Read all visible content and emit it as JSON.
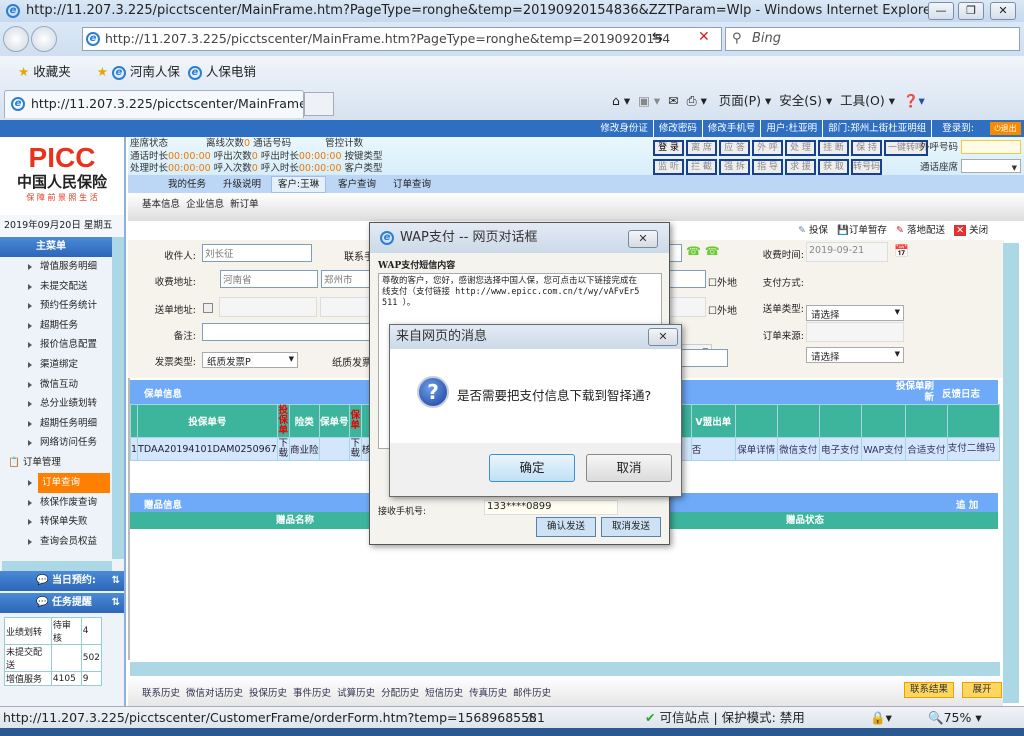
{
  "browser": {
    "title": "http://11.207.3.225/picctscenter/MainFrame.htm?PageType=ronghe&temp=20190920154836&ZZTParam=Wlp - Windows Internet Explorer",
    "address": "http://11.207.3.225/picctscenter/MainFrame.htm?PageType=ronghe&temp=20190920154",
    "search_placeholder": "Bing",
    "favorites": "收藏夹",
    "fav_links": [
      "河南人保",
      "人保电销"
    ],
    "tab_title": "http://11.207.3.225/picctscenter/MainFrame....",
    "commands": [
      "页面(P)",
      "安全(S)",
      "工具(O)"
    ],
    "status_url": "http://11.207.3.225/picctscenter/CustomerFrame/orderForm.htm?temp=15689685581",
    "trusted": "可信站点 | 保护模式: 禁用",
    "zoom": "75%"
  },
  "top_links": [
    "修改身份证",
    "修改密码",
    "修改手机号",
    "用户:杜亚明",
    "部门:郑州上街杜亚明组",
    "登录到:"
  ],
  "logout": "退出",
  "logo": {
    "brand": "PICC",
    "name": "中国人民保险",
    "slogan": "保 障 前 景 照 生 活"
  },
  "date": "2019年09月20日  星期五",
  "menu": {
    "header": "主菜单",
    "items": [
      "增值服务明细",
      "未提交配送",
      "预约任务统计",
      "超期任务",
      "报价信息配置",
      "渠道绑定",
      "微信互动",
      "总分业绩划转",
      "超期任务明细",
      "网络访问任务"
    ],
    "group": "订单管理",
    "group_items": [
      "订单查询",
      "核保作废查询",
      "转保单失败",
      "查询会员权益"
    ],
    "active": "订单查询"
  },
  "today_appt": "当日预约:",
  "task_remind": "任务提醒",
  "task_table": [
    [
      "业绩划转",
      "待审核",
      "4"
    ],
    [
      "未提交配送",
      "",
      "502"
    ],
    [
      "增值服务",
      "4105",
      "9"
    ]
  ],
  "status_panel": {
    "seat": "座席状态",
    "lost": "离线次数",
    "lost_v": "0",
    "callno": "通话号码",
    "ctrl": "管控计数",
    "talk": "通话时长",
    "talk_v": "00:00:00",
    "outc": "呼出次数",
    "outc_v": "0",
    "outt": "呼出时长",
    "outt_v": "00:00:00",
    "key": "按键类型",
    "proc": "处理时长",
    "proc_v": "00:00:00",
    "inc": "呼入次数",
    "inc_v": "0",
    "int": "呼入时长",
    "int_v": "00:00:00",
    "ctype": "客户类型"
  },
  "cti_row1": [
    "登 录",
    "离 席",
    "应 答",
    "外 呼",
    "处 理",
    "挂 断",
    "保 持",
    "一键转呼"
  ],
  "cti_row2": [
    "监 听",
    "拦 截",
    "强 拆",
    "指 导",
    "求 援",
    "获 取",
    "转号码"
  ],
  "outcall_label": "外呼号码",
  "seat_label": "通话座席",
  "tabs": [
    "我的任务",
    "升级说明",
    "客户:王琳",
    "客户查询",
    "订单查询"
  ],
  "subtabs": [
    "基本信息",
    "企业信息",
    "新订单"
  ],
  "toolbar": [
    "投保",
    "订单暂存",
    "落地配送",
    "关闭"
  ],
  "form": {
    "receiver_l": "收件人:",
    "receiver": "刘长征",
    "contact_l": "联系手",
    "addr_l": "收费地址:",
    "province": "河南省",
    "city": "郑州市",
    "send_l": "送单地址:",
    "remark_l": "备注:",
    "invoice_l": "发票类型:",
    "invoice": "纸质发票P",
    "paper_l": "纸质发票",
    "outside": "外地",
    "time_l": "收费时间:",
    "time": "2019-09-21",
    "pay_l": "支付方式:",
    "pay": "请选择",
    "sendtype_l": "送单类型:",
    "sendtype": "请选择",
    "source_l": "订单来源:"
  },
  "policy": {
    "header": "保单信息",
    "refresh": "投保单刷新",
    "feedback": "反馈日志",
    "cols": [
      "投保单号",
      "投保单",
      "险类",
      "保单号",
      "保单",
      "状",
      "入",
      "V盟出单",
      "",
      "",
      "",
      "",
      ""
    ],
    "row": [
      "1",
      "TDAA20194101DAM0250967",
      "下载",
      "商业险",
      "",
      "下载",
      "核保",
      "",
      "否",
      "保单详情",
      "微信支付",
      "电子支付",
      "WAP支付",
      "合适支付",
      "支付二维码"
    ]
  },
  "gift": {
    "header": "赠品信息",
    "add": "追 加",
    "col1": "赠品名称",
    "col2": "赠品状态"
  },
  "bottom_links": [
    "联系历史",
    "微信对话历史",
    "投保历史",
    "事件历史",
    "试算历史",
    "分配历史",
    "短信历史",
    "传真历史",
    "邮件历史"
  ],
  "bottom_btns": [
    "联系结果",
    "展开"
  ],
  "wap": {
    "title": "WAP支付 -- 网页对话框",
    "section": "WAP支付短信内容",
    "text": "尊敬的客户，您好，感谢您选择中国人保，您可点击以下链接完成在线支付（支付链接 http://www.epicc.com.cn/t/wy/vAFvEr5511 ）。",
    "phone_l": "接收手机号:",
    "phone": "133****0899",
    "confirm": "确认发送",
    "cancel": "取消发送"
  },
  "msg": {
    "title": "来自网页的消息",
    "text": "是否需要把支付信息下载到智择通?",
    "ok": "确定",
    "cancel": "取消"
  }
}
